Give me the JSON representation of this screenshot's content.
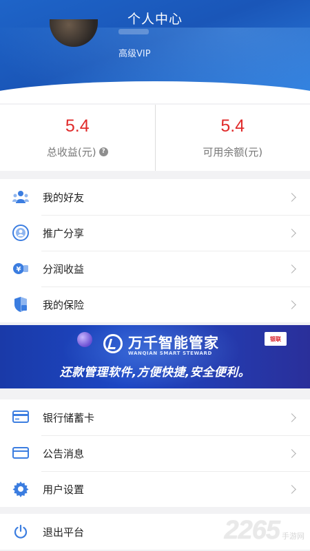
{
  "header": {
    "title": "个人中心",
    "vip_level": "高级VIP"
  },
  "stats": {
    "total_income": {
      "value": "5.4",
      "label": "总收益(元)"
    },
    "balance": {
      "value": "5.4",
      "label": "可用余额(元)"
    }
  },
  "menu_group_1": [
    {
      "label": "我的好友",
      "icon": "friends-icon"
    },
    {
      "label": "推广分享",
      "icon": "share-icon"
    },
    {
      "label": "分润收益",
      "icon": "profit-icon"
    },
    {
      "label": "我的保险",
      "icon": "insurance-icon"
    }
  ],
  "banner": {
    "title": "万千智能管家",
    "subtitle": "WANQIAN SMART STEWARD",
    "slogan": "还款管理软件,方便快捷,安全便利。"
  },
  "menu_group_2": [
    {
      "label": "银行储蓄卡",
      "icon": "bank-card-icon"
    },
    {
      "label": "公告消息",
      "icon": "notice-icon"
    },
    {
      "label": "用户设置",
      "icon": "settings-icon"
    }
  ],
  "menu_group_3": [
    {
      "label": "退出平台",
      "icon": "power-icon"
    }
  ],
  "watermark": {
    "number": "2265",
    "text": "手游网"
  },
  "colors": {
    "header_blue": "#1e64c8",
    "value_red": "#e02a2a",
    "icon_blue": "#3b7de0"
  }
}
